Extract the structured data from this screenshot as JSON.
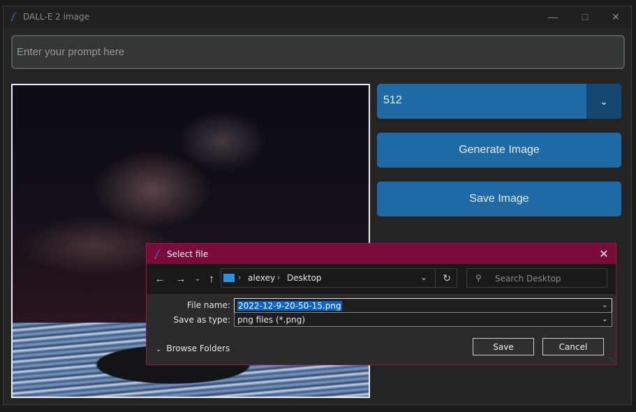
{
  "window": {
    "title": "DALL-E 2 image",
    "icon": "quill-icon"
  },
  "prompt": {
    "placeholder": "Enter your prompt here",
    "value": ""
  },
  "size_select": {
    "value": "512"
  },
  "buttons": {
    "generate": "Generate Image",
    "save": "Save Image"
  },
  "dialog": {
    "title": "Select file",
    "breadcrumbs": [
      "alexey",
      "Desktop"
    ],
    "search_placeholder": "Search Desktop",
    "file_name_label": "File name:",
    "file_name_value": "2022-12-9-20-50-15.png",
    "save_as_type_label": "Save as type:",
    "save_as_type_value": "png files (*.png)",
    "browse_folders": "Browse Folders",
    "save_button": "Save",
    "cancel_button": "Cancel"
  },
  "colors": {
    "accent": "#1f6aa5",
    "dialog_title": "#7a0c3c",
    "background": "#242424"
  }
}
